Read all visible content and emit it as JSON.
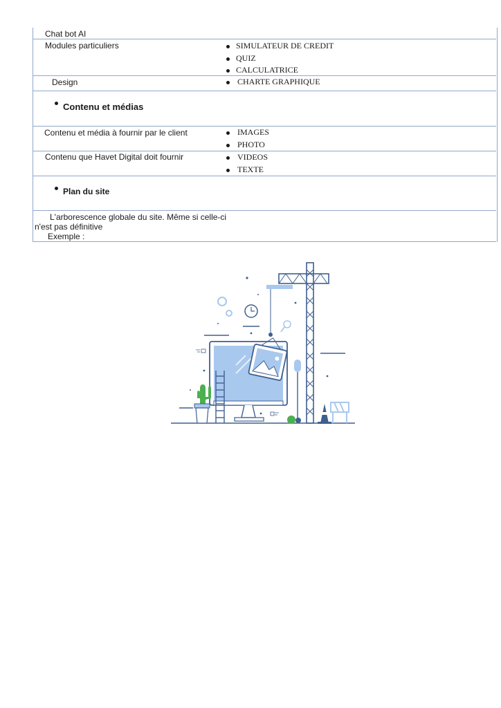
{
  "table": {
    "rows": [
      {
        "label": "Chat bot AI",
        "items": []
      },
      {
        "label": "Modules particuliers",
        "items": [
          "SIMULATEUR DE CREDIT",
          "QUIZ",
          "CALCULATRICE"
        ]
      },
      {
        "label": "Design",
        "items": [
          "CHARTE GRAPHIQUE"
        ]
      },
      {
        "section": "Contenu et médias"
      },
      {
        "label": "Contenu et média à fournir par le client",
        "items": [
          "IMAGES",
          "PHOTO"
        ]
      },
      {
        "label": "Contenu que Havet Digital doit fournir",
        "items": [
          "VIDEOS",
          "TEXTE"
        ]
      },
      {
        "section": "Plan du site"
      },
      {
        "label": "L'arborescence globale du site. Même si celle-ci n'est pas définitive",
        "extra": "Exemple :"
      }
    ]
  },
  "colors": {
    "border": "#8fa7c9",
    "illustration_blue": "#3f5f8f",
    "illustration_light": "#a9c8ee",
    "plant_green": "#4caf50"
  },
  "illustration": {
    "icon": "website-under-construction-illustration"
  }
}
